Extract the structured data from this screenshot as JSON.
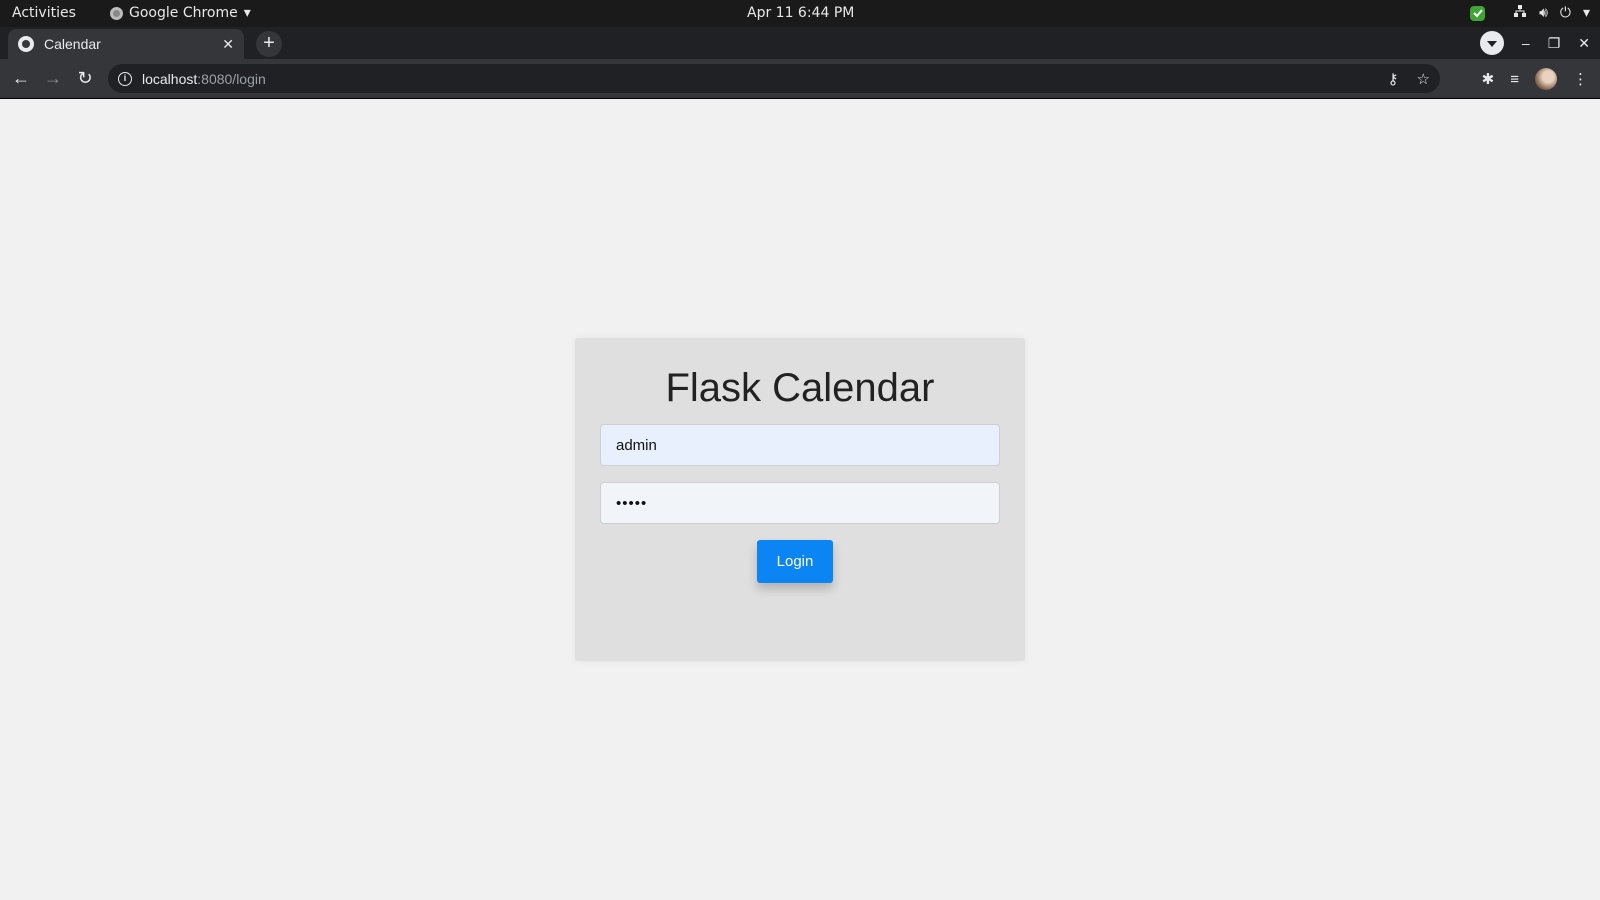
{
  "system_bar": {
    "activities": "Activities",
    "app_name": "Google Chrome",
    "clock": "Apr 11  6:44 PM"
  },
  "browser": {
    "tab_title": "Calendar",
    "url_host": "localhost",
    "url_path": ":8080/login"
  },
  "login": {
    "title": "Flask Calendar",
    "username_value": "admin",
    "password_value": "•••••",
    "button_label": "Login"
  },
  "colors": {
    "accent": "#0b84f4",
    "card_bg": "#dfdfdf",
    "page_bg": "#f1f1f1"
  }
}
